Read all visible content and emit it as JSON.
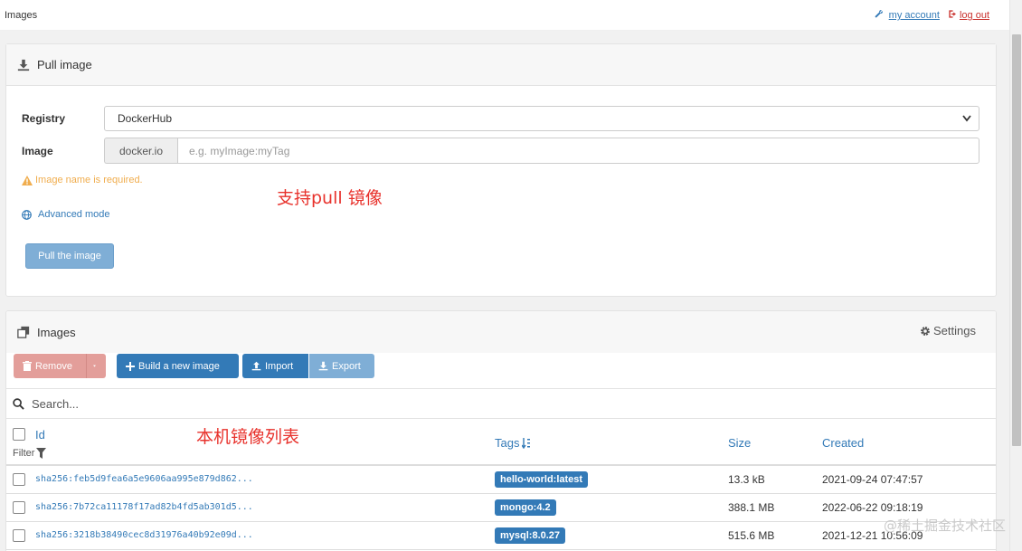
{
  "topbar": {
    "page_title": "Images",
    "my_account": "my account",
    "log_out": "log out"
  },
  "pull_panel": {
    "title": "Pull image",
    "registry_label": "Registry",
    "registry_value": "DockerHub",
    "image_label": "Image",
    "image_prefix": "docker.io",
    "image_placeholder": "e.g. myImage:myTag",
    "image_value": "",
    "warning": "Image name is required.",
    "advanced_mode": "Advanced mode",
    "pull_button": "Pull the image"
  },
  "annotations": {
    "pull_note": "支持pull 镜像",
    "list_note": "本机镜像列表"
  },
  "images_panel": {
    "title": "Images",
    "settings": "Settings",
    "toolbar": {
      "remove": "Remove",
      "build": "Build a new image",
      "import": "Import",
      "export": "Export"
    },
    "search_placeholder": "Search...",
    "columns": {
      "id": "Id",
      "filter": "Filter",
      "tags": "Tags",
      "size": "Size",
      "created": "Created"
    },
    "rows": [
      {
        "id": "sha256:feb5d9fea6a5e9606aa995e879d862...",
        "tag": "hello-world:latest",
        "size": "13.3 kB",
        "created": "2021-09-24 07:47:57"
      },
      {
        "id": "sha256:7b72ca11178f17ad82b4fd5ab301d5...",
        "tag": "mongo:4.2",
        "size": "388.1 MB",
        "created": "2022-06-22 09:18:19"
      },
      {
        "id": "sha256:3218b38490cec8d31976a40b92e09d...",
        "tag": "mysql:8.0.27",
        "size": "515.6 MB",
        "created": "2021-12-21 10:56:09"
      }
    ]
  },
  "watermark": "@稀土掘金技术社区",
  "colors": {
    "primary": "#337ab7",
    "primary_light": "#7faed6",
    "danger_light": "#e39e9a",
    "warning": "#f0ad4e",
    "annotation_red": "#e8322c"
  },
  "icons": {
    "pull_header": "download-icon",
    "images_header": "clone-icon",
    "settings": "gear-icon",
    "account": "wrench-icon",
    "logout": "sign-out-icon",
    "warning": "warning-icon",
    "advanced": "globe-icon",
    "remove": "trash-icon",
    "caret": "caret-down-icon",
    "build": "plus-icon",
    "import": "upload-icon",
    "export": "download-icon",
    "search": "search-icon",
    "filter": "filter-icon",
    "sort": "sort-icon"
  }
}
